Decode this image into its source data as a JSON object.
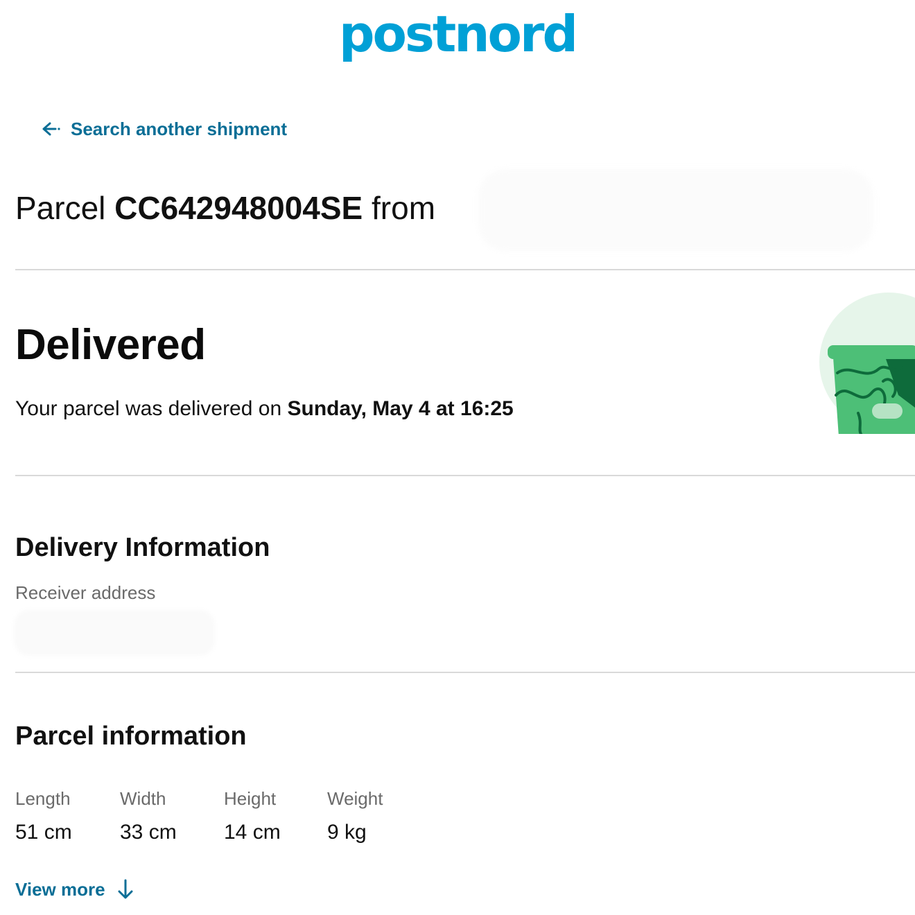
{
  "brand": {
    "logo_text": "postnord",
    "color": "#00a0d6"
  },
  "navigation": {
    "back_label": "Search another shipment",
    "back_icon": "arrow-left-icon",
    "link_color": "#0a6e96"
  },
  "parcel": {
    "prefix": "Parcel",
    "id": "CC642948004SE",
    "from_label": "from"
  },
  "status": {
    "title": "Delivered",
    "text_prefix": "Your parcel was delivered on",
    "delivered_at": "Sunday, May 4 at 16:25",
    "illustration_icon": "delivered-parcel-icon",
    "illustration_colors": {
      "circle": "#e6f5ea",
      "box": "#4dbf77",
      "box_dark": "#0e6b3b"
    }
  },
  "delivery_info": {
    "title": "Delivery Information",
    "receiver_label": "Receiver address"
  },
  "parcel_info": {
    "title": "Parcel information",
    "dimensions": [
      {
        "label": "Length",
        "value": "51 cm"
      },
      {
        "label": "Width",
        "value": "33 cm"
      },
      {
        "label": "Height",
        "value": "14 cm"
      },
      {
        "label": "Weight",
        "value": "9 kg"
      }
    ],
    "view_more_label": "View more",
    "view_more_icon": "arrow-down-icon"
  }
}
